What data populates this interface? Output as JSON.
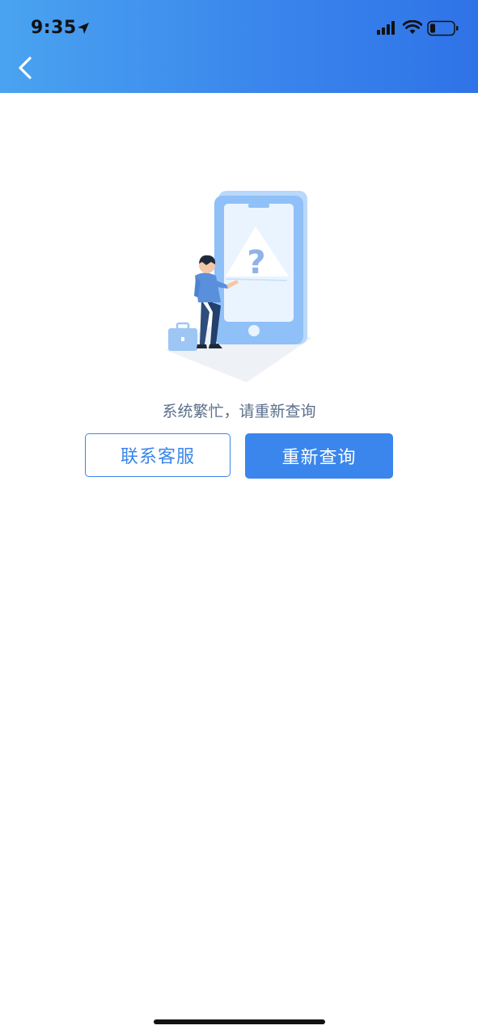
{
  "status_bar": {
    "time": "9:35"
  },
  "header": {
    "back_icon": "chevron-left-icon"
  },
  "main": {
    "message": "系统繁忙，请重新查询",
    "buttons": {
      "contact_label": "联系客服",
      "retry_label": "重新查询"
    }
  },
  "colors": {
    "accent": "#3a86ec",
    "header_gradient_start": "#4aa3f0",
    "header_gradient_end": "#2f73e8",
    "message_text": "#5c6f8c"
  }
}
